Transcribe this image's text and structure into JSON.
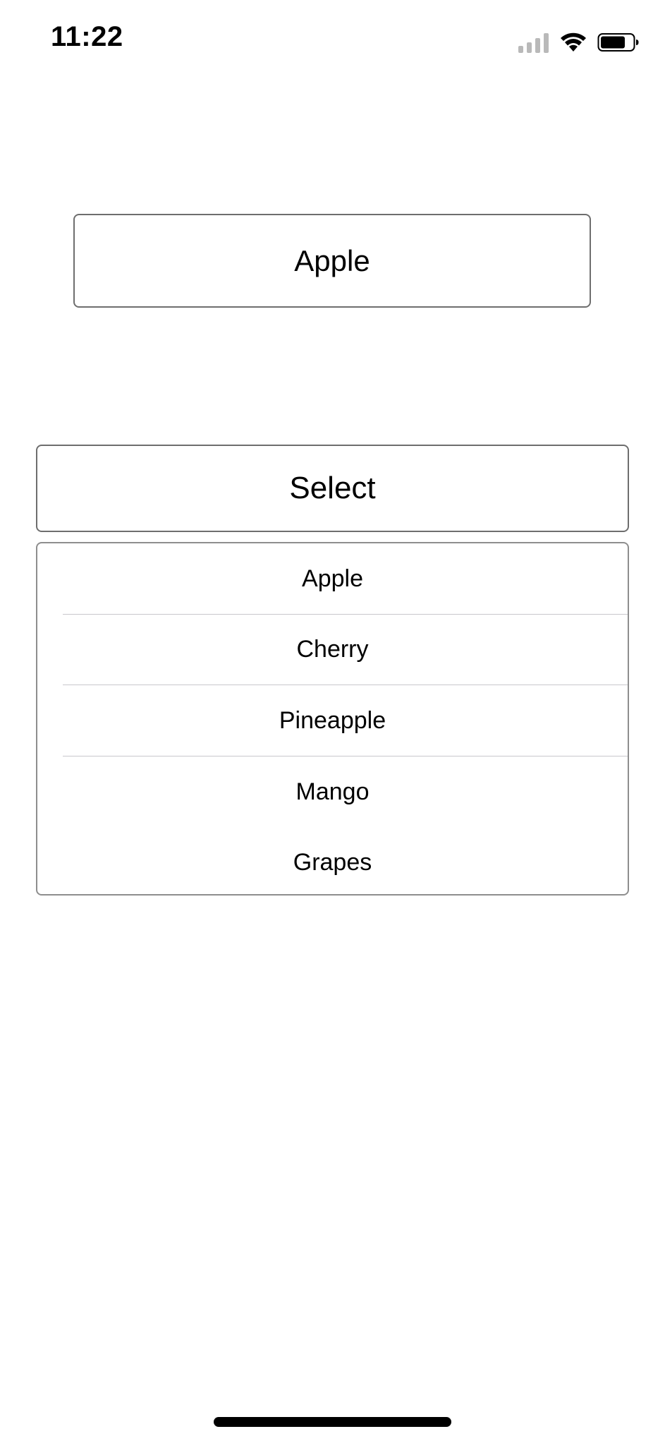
{
  "status_bar": {
    "time": "11:22",
    "icons": [
      "cellular-signal-icon",
      "wifi-icon",
      "battery-icon"
    ]
  },
  "selected_value": "Apple",
  "select_button": {
    "label": "Select"
  },
  "dropdown": {
    "items": [
      {
        "label": "Apple"
      },
      {
        "label": "Cherry"
      },
      {
        "label": "Pineapple"
      },
      {
        "label": "Mango"
      },
      {
        "label": "Grapes"
      }
    ]
  },
  "colors": {
    "border": "#6e6e6e",
    "separator": "#c8c7cc",
    "text": "#000000",
    "background": "#ffffff"
  }
}
